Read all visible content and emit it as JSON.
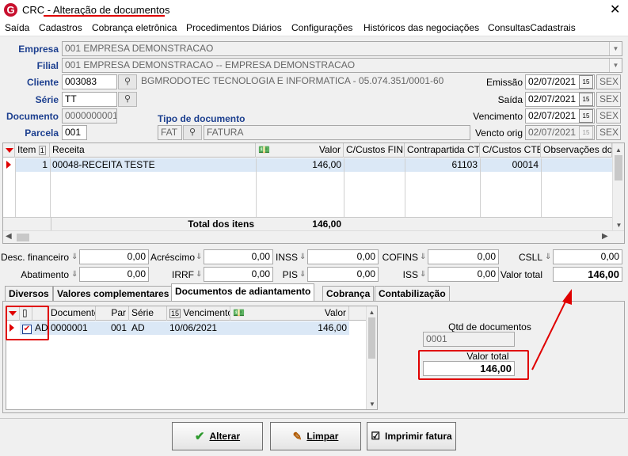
{
  "window": {
    "app": "CRC",
    "separator": " - ",
    "title": "Alteração de documentos"
  },
  "menu": [
    "Saída",
    "Cadastros",
    "Cobrança eletrônica",
    "Procedimentos Diários",
    "Configurações",
    "Históricos das negociações",
    "ConsultasCadastrais"
  ],
  "form": {
    "empresa": {
      "label": "Empresa",
      "value": "001 EMPRESA DEMONSTRACAO"
    },
    "filial": {
      "label": "Filial",
      "value": "001 EMPRESA DEMONSTRACAO -- EMPRESA DEMONSTRACAO"
    },
    "cliente": {
      "label": "Cliente",
      "code": "003083",
      "name": "BGMRODOTEC TECNOLOGIA  E INFORMATICA - 05.074.351/0001-60"
    },
    "serie": {
      "label": "Série",
      "value": "TT"
    },
    "documento": {
      "label": "Documento",
      "value": "0000000001"
    },
    "parcela": {
      "label": "Parcela",
      "value": "001"
    },
    "tipo_documento": {
      "label": "Tipo de documento",
      "code": "FAT",
      "name": "FATURA"
    },
    "emissao": {
      "label": "Emissão",
      "date": "02/07/2021",
      "day": "SEX"
    },
    "saida": {
      "label": "Saída",
      "date": "02/07/2021",
      "day": "SEX"
    },
    "vencimento": {
      "label": "Vencimento",
      "date": "02/07/2021",
      "day": "SEX"
    },
    "vencto_orig": {
      "label": "Vencto orig",
      "date": "02/07/2021",
      "day": "SEX"
    }
  },
  "items_grid": {
    "headers": {
      "item": "Item",
      "sort": "1",
      "receita": "Receita",
      "valor": "Valor",
      "cc_fin": "C/Custos FIN",
      "contrapartida": "Contrapartida CTB",
      "cc_ctb": "C/Custos CTB",
      "obs": "Observações do ite"
    },
    "rows": [
      {
        "item": "1",
        "receita": "00048-RECEITA TESTE",
        "valor": "146,00",
        "cc_fin": "",
        "contrapartida": "61103",
        "cc_ctb": "00014",
        "obs": ""
      }
    ],
    "total_label": "Total dos itens",
    "total_value": "146,00"
  },
  "totals": {
    "desc_financeiro": {
      "label": "Desc. financeiro",
      "value": "0,00"
    },
    "acrescimo": {
      "label": "Acréscimo",
      "value": "0,00"
    },
    "inss": {
      "label": "INSS",
      "value": "0,00"
    },
    "cofins": {
      "label": "COFINS",
      "value": "0,00"
    },
    "csll": {
      "label": "CSLL",
      "value": "0,00"
    },
    "abatimento": {
      "label": "Abatimento",
      "value": "0,00"
    },
    "irrf": {
      "label": "IRRF",
      "value": "0,00"
    },
    "pis": {
      "label": "PIS",
      "value": "0,00"
    },
    "iss": {
      "label": "ISS",
      "value": "0,00"
    },
    "valor_total": {
      "label": "Valor total",
      "value": "146,00"
    }
  },
  "tabs": [
    "Diversos",
    "Valores complementares",
    "Documentos de adiantamento",
    "Cobrança",
    "Contabilização"
  ],
  "adiant_grid": {
    "headers": {
      "documento": "Documento",
      "par": "Par",
      "serie": "Série",
      "vencimento": "Vencimento",
      "valor": "Valor"
    },
    "rows": [
      {
        "tipo": "AD",
        "documento": "0000001",
        "par": "001",
        "serie": "AD",
        "vencimento": "10/06/2021",
        "valor": "146,00",
        "checked": true
      }
    ]
  },
  "side": {
    "qtd_label": "Qtd de documentos",
    "qtd_value": "0001",
    "valor_label": "Valor total",
    "valor_value": "146,00"
  },
  "buttons": {
    "alterar": "Alterar",
    "limpar": "Limpar",
    "imprimir": "Imprimir fatura"
  },
  "colors": {
    "accent_red": "#e00000",
    "label_blue": "#1c3f8f",
    "selection": "#dbe8f6"
  }
}
